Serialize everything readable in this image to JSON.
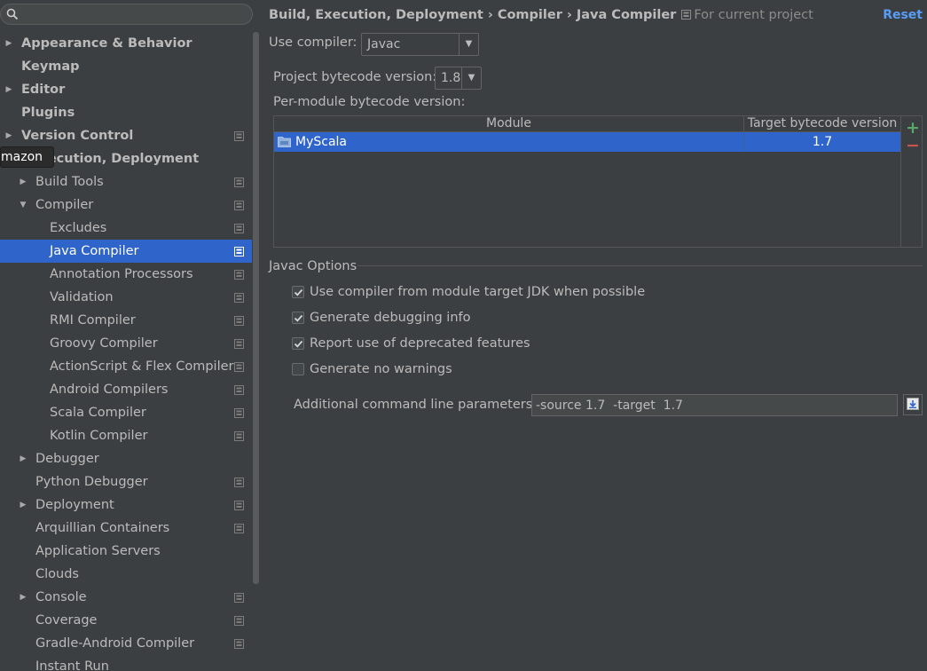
{
  "search": {
    "placeholder": ""
  },
  "tooltip": {
    "text": "mazon"
  },
  "sidebar": {
    "items": [
      {
        "label": "Appearance & Behavior",
        "level": 0,
        "expander": "collapsed",
        "bold": true,
        "project": false
      },
      {
        "label": "Keymap",
        "level": 0,
        "expander": "none",
        "bold": true,
        "project": false
      },
      {
        "label": "Editor",
        "level": 0,
        "expander": "collapsed",
        "bold": true,
        "project": false
      },
      {
        "label": "Plugins",
        "level": 0,
        "expander": "none",
        "bold": true,
        "project": false
      },
      {
        "label": "Version Control",
        "level": 0,
        "expander": "collapsed",
        "bold": true,
        "project": true
      },
      {
        "label": ", Execution, Deployment",
        "level": 0,
        "expander": "none",
        "bold": true,
        "project": false
      },
      {
        "label": "Build Tools",
        "level": 1,
        "expander": "collapsed",
        "bold": false,
        "project": true
      },
      {
        "label": "Compiler",
        "level": 1,
        "expander": "expanded",
        "bold": false,
        "project": true
      },
      {
        "label": "Excludes",
        "level": 2,
        "expander": "none",
        "bold": false,
        "project": true
      },
      {
        "label": "Java Compiler",
        "level": 2,
        "expander": "none",
        "bold": false,
        "project": true,
        "selected": true
      },
      {
        "label": "Annotation Processors",
        "level": 2,
        "expander": "none",
        "bold": false,
        "project": true
      },
      {
        "label": "Validation",
        "level": 2,
        "expander": "none",
        "bold": false,
        "project": true
      },
      {
        "label": "RMI Compiler",
        "level": 2,
        "expander": "none",
        "bold": false,
        "project": true
      },
      {
        "label": "Groovy Compiler",
        "level": 2,
        "expander": "none",
        "bold": false,
        "project": true
      },
      {
        "label": "ActionScript & Flex Compiler",
        "level": 2,
        "expander": "none",
        "bold": false,
        "project": true
      },
      {
        "label": "Android Compilers",
        "level": 2,
        "expander": "none",
        "bold": false,
        "project": true
      },
      {
        "label": "Scala Compiler",
        "level": 2,
        "expander": "none",
        "bold": false,
        "project": true
      },
      {
        "label": "Kotlin Compiler",
        "level": 2,
        "expander": "none",
        "bold": false,
        "project": true
      },
      {
        "label": "Debugger",
        "level": 1,
        "expander": "collapsed",
        "bold": false,
        "project": false
      },
      {
        "label": "Python Debugger",
        "level": 1,
        "expander": "none",
        "bold": false,
        "project": true
      },
      {
        "label": "Deployment",
        "level": 1,
        "expander": "collapsed",
        "bold": false,
        "project": true
      },
      {
        "label": "Arquillian Containers",
        "level": 1,
        "expander": "none",
        "bold": false,
        "project": true
      },
      {
        "label": "Application Servers",
        "level": 1,
        "expander": "none",
        "bold": false,
        "project": false
      },
      {
        "label": "Clouds",
        "level": 1,
        "expander": "none",
        "bold": false,
        "project": false
      },
      {
        "label": "Console",
        "level": 1,
        "expander": "collapsed",
        "bold": false,
        "project": true
      },
      {
        "label": "Coverage",
        "level": 1,
        "expander": "none",
        "bold": false,
        "project": true
      },
      {
        "label": "Gradle-Android Compiler",
        "level": 1,
        "expander": "none",
        "bold": false,
        "project": true
      },
      {
        "label": "Instant Run",
        "level": 1,
        "expander": "none",
        "bold": false,
        "project": false
      }
    ]
  },
  "header": {
    "breadcrumb": [
      "Build, Execution, Deployment",
      "Compiler",
      "Java Compiler"
    ],
    "separator": "›",
    "scope": "For current project",
    "reset": "Reset"
  },
  "form": {
    "use_compiler_label": "Use compiler:",
    "use_compiler_value": "Javac",
    "project_bytecode_label": "Project bytecode version:",
    "project_bytecode_value": "1.8",
    "per_module_label": "Per-module bytecode version:",
    "table": {
      "columns": [
        "Module",
        "Target bytecode version"
      ],
      "rows": [
        {
          "module": "MyScala",
          "version": "1.7"
        }
      ],
      "add": "+",
      "remove": "−"
    },
    "javac_options_title": "Javac Options",
    "checkboxes": [
      {
        "label": "Use compiler from module target JDK when possible",
        "checked": true
      },
      {
        "label": "Generate debugging info",
        "checked": true
      },
      {
        "label": "Report use of deprecated features",
        "checked": true
      },
      {
        "label": "Generate no warnings",
        "checked": false
      }
    ],
    "params_label": "Additional command line parameters:",
    "params_value": "-source 1.7  -target  1.7"
  },
  "colors": {
    "accent": "#2f65ca",
    "link": "#589df6",
    "add": "#59a869",
    "remove": "#c75450"
  }
}
